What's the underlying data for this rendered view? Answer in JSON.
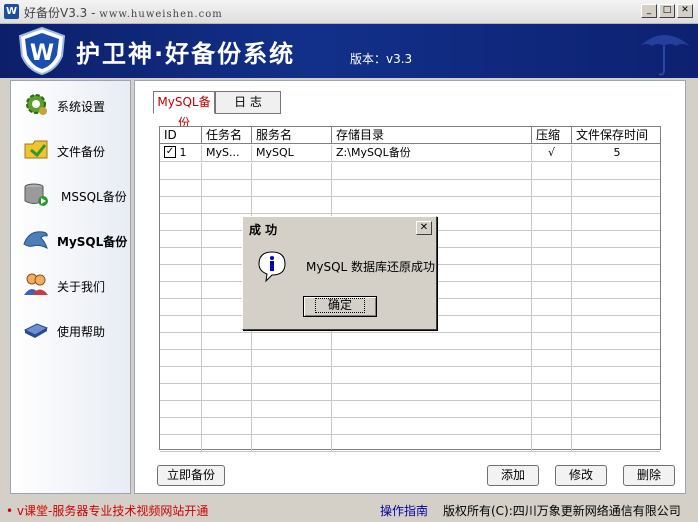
{
  "window": {
    "title": "好备份V3.3 - ",
    "url": "www.huweishen.com",
    "min_label": "_",
    "max_label": "□",
    "close_label": "✕"
  },
  "banner": {
    "title": "护卫神·好备份系统",
    "version": "版本：v3.3"
  },
  "sidebar": {
    "items": [
      {
        "label": "系统设置",
        "icon": "gear-icon"
      },
      {
        "label": "文件备份",
        "icon": "folder-icon"
      },
      {
        "label": "MSSQL备份",
        "icon": "database-icon"
      },
      {
        "label": "MySQL备份",
        "icon": "dolphin-icon"
      },
      {
        "label": "关于我们",
        "icon": "people-icon"
      },
      {
        "label": "使用帮助",
        "icon": "book-icon"
      }
    ]
  },
  "tabs": [
    {
      "label": "MySQL备份"
    },
    {
      "label": "日 志"
    }
  ],
  "table": {
    "headers": [
      "ID",
      "任务名",
      "服务名",
      "存储目录",
      "压缩",
      "文件保存时间"
    ],
    "rows": [
      {
        "checked": true,
        "id": "1",
        "task": "MyS...",
        "service": "MySQL",
        "dir": "Z:\\MySQL备份",
        "compress": "√",
        "keep": "5"
      }
    ]
  },
  "buttons": {
    "backup_now": "立即备份",
    "add": "添加",
    "edit": "修改",
    "delete": "删除"
  },
  "dialog": {
    "title": "成 功",
    "message": "MySQL 数据库还原成功",
    "ok": "确定",
    "close": "✕"
  },
  "status": {
    "promo": "• v课堂-服务器专业技术视频网站开通",
    "guide": "操作指南",
    "copyright": "版权所有(C):四川万象更新网络通信有限公司"
  },
  "colors": {
    "banner": "#12308a",
    "promo": "#d00000",
    "guide": "#0000a0",
    "active_tab": "#c00000"
  }
}
